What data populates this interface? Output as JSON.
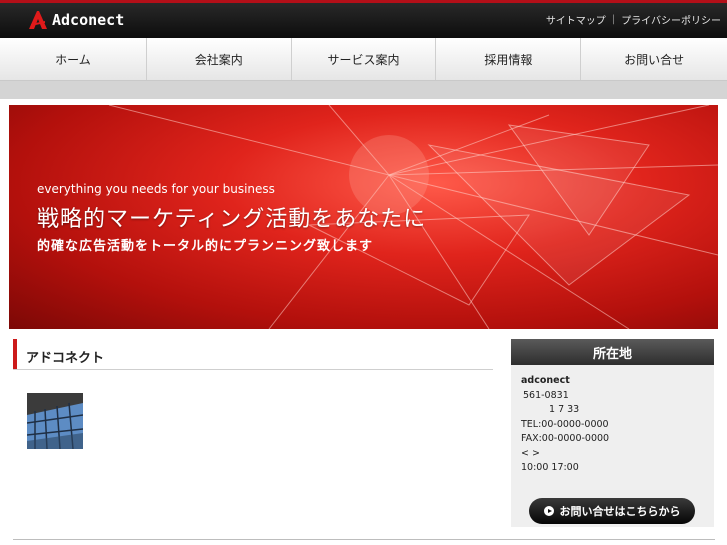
{
  "header": {
    "logo_text": "Adconect",
    "links": [
      "サイトマップ",
      "プライバシーポリシー"
    ]
  },
  "nav": {
    "items": [
      "ホーム",
      "会社案内",
      "サービス案内",
      "採用情報",
      "お問い合せ"
    ]
  },
  "hero": {
    "subtitle": "everything you needs for your business",
    "title": "戦略的マーケティング活動をあなたに",
    "lead": "的確な広告活動をトータル的にプランニング致します"
  },
  "main": {
    "section_title": "アドコネクト"
  },
  "sidebar": {
    "title": "所在地",
    "company": "adconect",
    "postal": "561-0831",
    "address": "1 7 33",
    "tel": "TEL:00-0000-0000",
    "fax": "FAX:00-0000-0000",
    "days": "< >",
    "hours": "10:00 17:00",
    "contact_button": "お問い合せはこちらから"
  },
  "colors": {
    "accent": "#cc1a1a",
    "topbar": "#111111"
  }
}
